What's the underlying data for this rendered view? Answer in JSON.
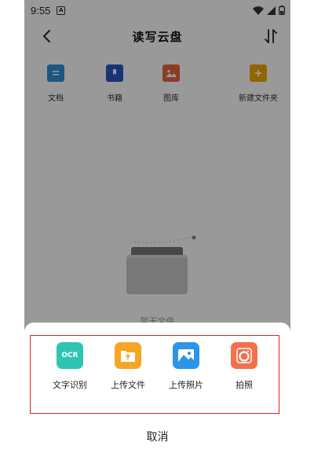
{
  "status_bar": {
    "time": "9:55",
    "notification_glyph": "A"
  },
  "header": {
    "title": "读写云盘"
  },
  "quick_actions": [
    {
      "label": "文档",
      "icon": "document-icon",
      "color": "#2f8fd6"
    },
    {
      "label": "书籍",
      "icon": "book-icon",
      "color": "#2a56c6"
    },
    {
      "label": "图库",
      "icon": "gallery-icon",
      "color": "#e8643c"
    },
    {
      "label": "新建文件夹",
      "icon": "new-folder-icon",
      "color": "#f2a900"
    }
  ],
  "empty_state": {
    "text": "暂无文件"
  },
  "upload_sheet": {
    "actions": [
      {
        "label": "文字识别",
        "icon": "ocr-icon",
        "color": "#2fc4b2",
        "icon_text": "OCR"
      },
      {
        "label": "上传文件",
        "icon": "upload-file-icon",
        "color": "#f5a623"
      },
      {
        "label": "上传照片",
        "icon": "upload-photo-icon",
        "color": "#2c95e8"
      },
      {
        "label": "拍照",
        "icon": "camera-icon",
        "color": "#f4704c"
      }
    ],
    "cancel_label": "取消",
    "highlight_color": "#e21f26"
  }
}
